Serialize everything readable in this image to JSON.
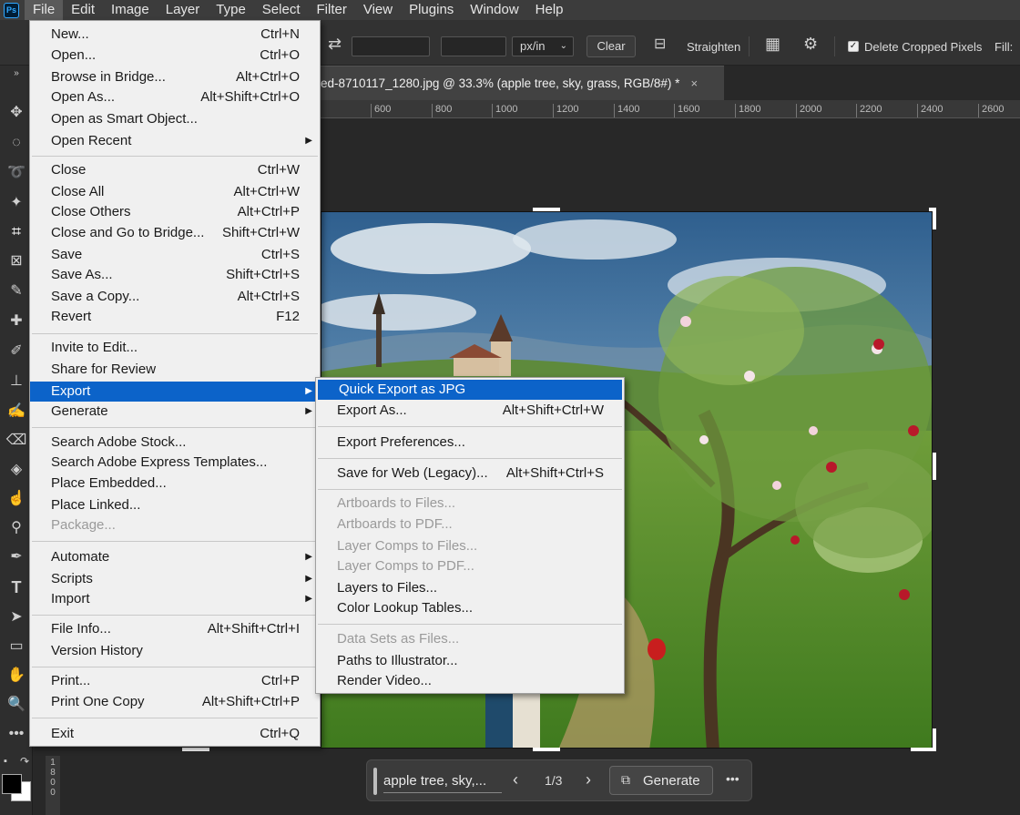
{
  "menubar": {
    "logo": "Ps",
    "items": [
      "File",
      "Edit",
      "Image",
      "Layer",
      "Type",
      "Select",
      "Filter",
      "View",
      "Plugins",
      "Window",
      "Help"
    ]
  },
  "options_bar": {
    "unit": "px/in",
    "clear_label": "Clear",
    "straighten_label": "Straighten",
    "delete_cropped_label": "Delete Cropped Pixels",
    "fill_label": "Fill:"
  },
  "document_tab": {
    "title": "ed-8710117_1280.jpg @ 33.3% (apple tree, sky, grass, RGB/8#) *",
    "close": "×"
  },
  "ruler": {
    "ticks": [
      "600",
      "800",
      "1000",
      "1200",
      "1400",
      "1600",
      "1800",
      "2000",
      "2200",
      "2400",
      "2600"
    ],
    "vertical": [
      "1",
      "8",
      "0",
      "0"
    ]
  },
  "file_menu": {
    "items": [
      {
        "label": "New...",
        "shortcut": "Ctrl+N"
      },
      {
        "label": "Open...",
        "shortcut": "Ctrl+O"
      },
      {
        "label": "Browse in Bridge...",
        "shortcut": "Alt+Ctrl+O"
      },
      {
        "label": "Open As...",
        "shortcut": "Alt+Shift+Ctrl+O"
      },
      {
        "label": "Open as Smart Object...",
        "shortcut": ""
      },
      {
        "label": "Open Recent",
        "shortcut": ""
      },
      {
        "label": "Close",
        "shortcut": "Ctrl+W"
      },
      {
        "label": "Close All",
        "shortcut": "Alt+Ctrl+W"
      },
      {
        "label": "Close Others",
        "shortcut": "Alt+Ctrl+P"
      },
      {
        "label": "Close and Go to Bridge...",
        "shortcut": "Shift+Ctrl+W"
      },
      {
        "label": "Save",
        "shortcut": "Ctrl+S"
      },
      {
        "label": "Save As...",
        "shortcut": "Shift+Ctrl+S"
      },
      {
        "label": "Save a Copy...",
        "shortcut": "Alt+Ctrl+S"
      },
      {
        "label": "Revert",
        "shortcut": "F12"
      },
      {
        "label": "Invite to Edit...",
        "shortcut": ""
      },
      {
        "label": "Share for Review",
        "shortcut": ""
      },
      {
        "label": "Export",
        "shortcut": ""
      },
      {
        "label": "Generate",
        "shortcut": ""
      },
      {
        "label": "Search Adobe Stock...",
        "shortcut": ""
      },
      {
        "label": "Search Adobe Express Templates...",
        "shortcut": ""
      },
      {
        "label": "Place Embedded...",
        "shortcut": ""
      },
      {
        "label": "Place Linked...",
        "shortcut": ""
      },
      {
        "label": "Package...",
        "shortcut": ""
      },
      {
        "label": "Automate",
        "shortcut": ""
      },
      {
        "label": "Scripts",
        "shortcut": ""
      },
      {
        "label": "Import",
        "shortcut": ""
      },
      {
        "label": "File Info...",
        "shortcut": "Alt+Shift+Ctrl+I"
      },
      {
        "label": "Version History",
        "shortcut": ""
      },
      {
        "label": "Print...",
        "shortcut": "Ctrl+P"
      },
      {
        "label": "Print One Copy",
        "shortcut": "Alt+Shift+Ctrl+P"
      },
      {
        "label": "Exit",
        "shortcut": "Ctrl+Q"
      }
    ]
  },
  "export_menu": {
    "items": [
      {
        "label": "Quick Export as JPG",
        "shortcut": ""
      },
      {
        "label": "Export As...",
        "shortcut": "Alt+Shift+Ctrl+W"
      },
      {
        "label": "Export Preferences...",
        "shortcut": ""
      },
      {
        "label": "Save for Web (Legacy)...",
        "shortcut": "Alt+Shift+Ctrl+S"
      },
      {
        "label": "Artboards to Files...",
        "shortcut": ""
      },
      {
        "label": "Artboards to PDF...",
        "shortcut": ""
      },
      {
        "label": "Layer Comps to Files...",
        "shortcut": ""
      },
      {
        "label": "Layer Comps to PDF...",
        "shortcut": ""
      },
      {
        "label": "Layers to Files...",
        "shortcut": ""
      },
      {
        "label": "Color Lookup Tables...",
        "shortcut": ""
      },
      {
        "label": "Data Sets as Files...",
        "shortcut": ""
      },
      {
        "label": "Paths to Illustrator...",
        "shortcut": ""
      },
      {
        "label": "Render Video...",
        "shortcut": ""
      }
    ]
  },
  "gen_bar": {
    "prompt": "apple tree, sky,...",
    "page": "1/3",
    "generate_label": "Generate",
    "more": "•••"
  },
  "colors": {
    "menu_highlight": "#0c63c9",
    "menu_bg": "#f0f0f0",
    "app_bg": "#282828"
  }
}
